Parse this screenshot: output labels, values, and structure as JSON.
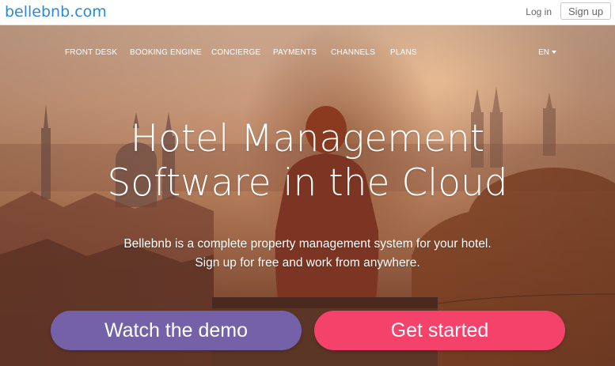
{
  "header": {
    "logo": "bellebnb.com",
    "login": "Log in",
    "signup": "Sign up"
  },
  "nav": {
    "items": [
      {
        "label": "FRONT DESK"
      },
      {
        "label": "BOOKING ENGINE"
      },
      {
        "label": "CONCIERGE"
      },
      {
        "label": "PAYMENTS"
      },
      {
        "label": "CHANNELS"
      },
      {
        "label": "PLANS"
      }
    ],
    "language": "EN"
  },
  "hero": {
    "headline_line1": "Hotel Management",
    "headline_line2": "Software in the Cloud",
    "sub_line1": "Bellebnb is a complete property management system for your hotel.",
    "sub_line2": "Sign up for free and work from anywhere."
  },
  "cta": {
    "demo": "Watch the demo",
    "start": "Get started"
  },
  "colors": {
    "brand_blue": "#2d88d6",
    "demo_purple": "#7461a8",
    "start_pink": "#f4426b"
  },
  "icons": {
    "language_caret": "caret-down-icon"
  }
}
